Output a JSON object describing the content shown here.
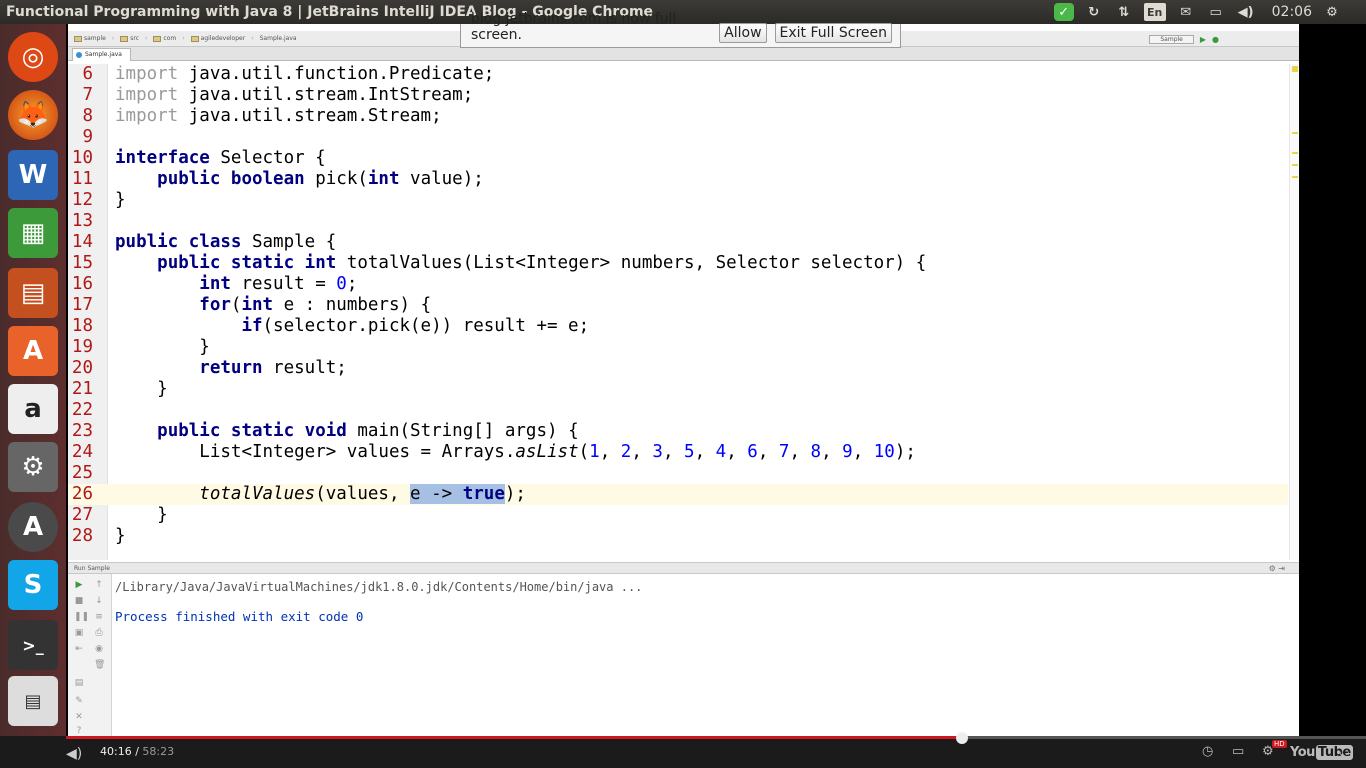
{
  "window": {
    "title": "Functional Programming with Java 8 | JetBrains IntelliJ IDEA Blog - Google Chrome"
  },
  "tray": {
    "lang": "En",
    "clock": "02:06"
  },
  "breadcrumbs": [
    "sample",
    "src",
    "com",
    "agiledeveloper",
    "Sample.java"
  ],
  "run_config": "Sample",
  "editor_tab": "Sample.java",
  "notice": {
    "message": "blog.jetbrains.com is now full screen.",
    "allow": "Allow",
    "exit": "Exit Full Screen"
  },
  "code": {
    "line_numbers": [
      "6",
      "7",
      "8",
      "9",
      "10",
      "11",
      "12",
      "13",
      "14",
      "15",
      "16",
      "17",
      "18",
      "19",
      "20",
      "21",
      "22",
      "23",
      "24",
      "25",
      "26",
      "27",
      "28"
    ],
    "l6_kw": "import",
    "l6_rest": " java.util.function.Predicate;",
    "l7_kw": "import",
    "l7_rest": " java.util.stream.IntStream;",
    "l8_kw": "import",
    "l8_rest": " java.util.stream.Stream;",
    "l10_kw": "interface",
    "l10_rest": " Selector {",
    "l11_kw": "public boolean",
    "l11_a": " pick(",
    "l11_kw2": "int",
    "l11_b": " value);",
    "l12": "}",
    "l14_kw": "public class",
    "l14_rest": " Sample {",
    "l15_kw": "public static int",
    "l15_rest": " totalValues(List<Integer> numbers, Selector selector) {",
    "l16_kw": "int",
    "l16_a": " result = ",
    "l16_num": "0",
    "l16_b": ";",
    "l17_kw": "for",
    "l17_a": "(",
    "l17_kw2": "int",
    "l17_b": " e : numbers) {",
    "l18_kw": "if",
    "l18_rest": "(selector.pick(e)) result += e;",
    "l19": "}",
    "l20_kw": "return",
    "l20_rest": " result;",
    "l21": "}",
    "l23_kw": "public static void",
    "l23_rest": " main(String[] args) {",
    "l24_a": "List<Integer> values = Arrays.",
    "l24_it": "asList",
    "l24_nums": [
      "1",
      "2",
      "3",
      "5",
      "4",
      "6",
      "7",
      "8",
      "9",
      "10"
    ],
    "l24_end": ");",
    "l26_it": "totalValues",
    "l26_a": "(values, ",
    "l26_sel_a": "e -> ",
    "l26_sel_kw": "true",
    "l26_b": ");",
    "l27": "}",
    "l28": "}"
  },
  "run_panel": {
    "header": "Run",
    "tab": "Sample",
    "command": "/Library/Java/JavaVirtualMachines/jdk1.8.0.jdk/Contents/Home/bin/java ...",
    "result": "Process finished with exit code 0"
  },
  "player": {
    "current": "40:16",
    "duration": "58:23",
    "progress": 0.6896,
    "hd": "HD",
    "logo_you": "You",
    "logo_tube": "Tube"
  }
}
